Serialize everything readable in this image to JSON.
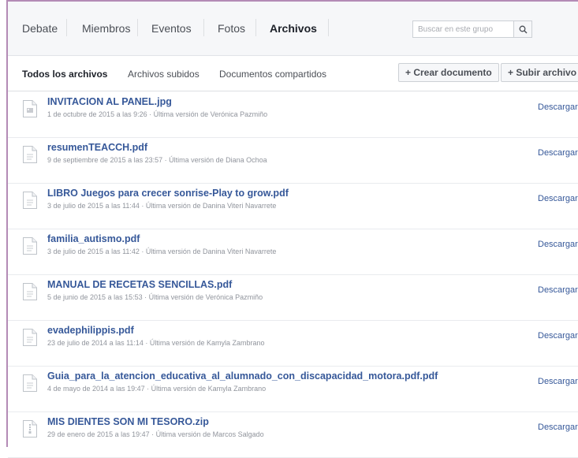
{
  "nav": {
    "tabs": [
      "Debate",
      "Miembros",
      "Eventos",
      "Fotos",
      "Archivos"
    ],
    "search_placeholder": "Buscar en este grupo"
  },
  "subnav": {
    "tabs": [
      "Todos los archivos",
      "Archivos subidos",
      "Documentos compartidos"
    ],
    "create_label": "+ Crear documento",
    "upload_label": "+ Subir archivo"
  },
  "files": [
    {
      "name": "INVITACION AL PANEL.jpg",
      "meta": "1 de octubre de 2015 a las 9:26 · Última versión de Verónica Pazmiño",
      "action": "Descargar",
      "icon": "image-file-icon"
    },
    {
      "name": "resumenTEACCH.pdf",
      "meta": "9 de septiembre de 2015 a las 23:57 · Última versión de Diana Ochoa",
      "action": "Descargar",
      "icon": "document-file-icon"
    },
    {
      "name": "LIBRO Juegos para crecer sonrise-Play to grow.pdf",
      "meta": "3 de julio de 2015 a las 11:44 · Última versión de Danina Viteri Navarrete",
      "action": "Descargar",
      "icon": "document-file-icon"
    },
    {
      "name": "familia_autismo.pdf",
      "meta": "3 de julio de 2015 a las 11:42 · Última versión de Danina Viteri Navarrete",
      "action": "Descargar",
      "icon": "document-file-icon"
    },
    {
      "name": "MANUAL DE RECETAS SENCILLAS.pdf",
      "meta": "5 de junio de 2015 a las 15:53 · Última versión de Verónica Pazmiño",
      "action": "Descargar",
      "icon": "document-file-icon"
    },
    {
      "name": "evadephilippis.pdf",
      "meta": "23 de julio de 2014 a las 11:14 · Última versión de Kamyla Zambrano",
      "action": "Descargar",
      "icon": "document-file-icon"
    },
    {
      "name": "Guia_para_la_atencion_educativa_al_alumnado_con_discapacidad_motora.pdf.pdf",
      "meta": "4 de mayo de 2014 a las 19:47 · Última versión de Kamyla Zambrano",
      "action": "Descargar",
      "icon": "document-file-icon"
    },
    {
      "name": "MIS DIENTES SON MI TESORO.zip",
      "meta": "29 de enero de 2015 a las 19:47 · Última versión de Marcos Salgado",
      "action": "Descargar",
      "icon": "archive-file-icon"
    }
  ],
  "colors": {
    "link": "#365899",
    "meta": "#90949c",
    "frame_border": "#b48bb6",
    "nav_background": "#f6f7f9"
  }
}
